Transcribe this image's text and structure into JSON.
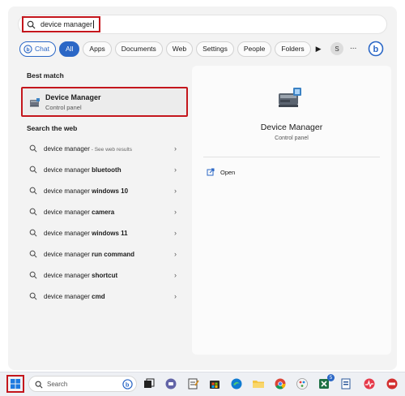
{
  "search": {
    "query": "device manager"
  },
  "filters": {
    "chat": "Chat",
    "items": [
      "All",
      "Apps",
      "Documents",
      "Web",
      "Settings",
      "People",
      "Folders"
    ],
    "avatar_letter": "S",
    "more": "..."
  },
  "best_match": {
    "heading": "Best match",
    "title": "Device Manager",
    "subtitle": "Control panel"
  },
  "web": {
    "heading": "Search the web",
    "items": [
      {
        "prefix": "device manager",
        "bold": "",
        "hint": " - See web results"
      },
      {
        "prefix": "device manager ",
        "bold": "bluetooth",
        "hint": ""
      },
      {
        "prefix": "device manager ",
        "bold": "windows 10",
        "hint": ""
      },
      {
        "prefix": "device manager ",
        "bold": "camera",
        "hint": ""
      },
      {
        "prefix": "device manager ",
        "bold": "windows 11",
        "hint": ""
      },
      {
        "prefix": "device manager ",
        "bold": "run command",
        "hint": ""
      },
      {
        "prefix": "device manager ",
        "bold": "shortcut",
        "hint": ""
      },
      {
        "prefix": "device manager ",
        "bold": "cmd",
        "hint": ""
      }
    ]
  },
  "detail": {
    "title": "Device Manager",
    "subtitle": "Control panel",
    "open_label": "Open"
  },
  "taskbar": {
    "search_placeholder": "Search",
    "teams_badge": "5",
    "colors": {
      "accent": "#2b67c6",
      "highlight": "#c4161c"
    }
  }
}
